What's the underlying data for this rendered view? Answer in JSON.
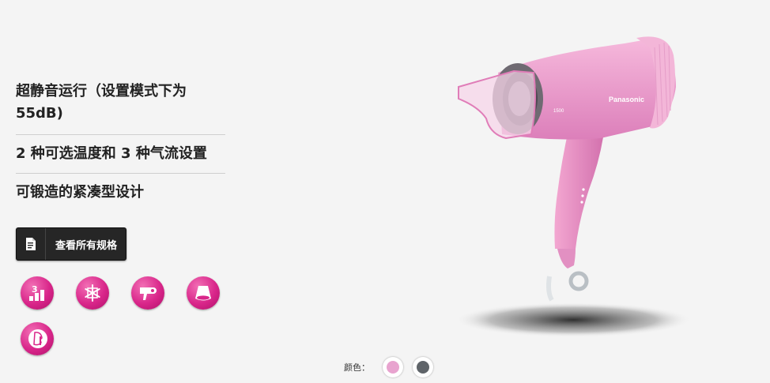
{
  "features": [
    "超静音运行（设置模式下为 55dB)",
    "2 种可选温度和 3 种气流设置",
    "可锻造的紧凑型设计"
  ],
  "spec_button": {
    "label": "查看所有规格",
    "icon": "document-icon"
  },
  "feature_icons": [
    "airflow-3-level-icon",
    "cool-snowflake-icon",
    "hair-dryer-icon",
    "concentrator-nozzle-icon",
    "quiet-shh-icon"
  ],
  "product": {
    "brand": "Panasonic",
    "wattage": "1500",
    "color": "#f09cc9"
  },
  "color_picker": {
    "label": "颜色：",
    "swatches": [
      {
        "name": "pink",
        "color": "#e8a3cf"
      },
      {
        "name": "gray",
        "color": "#5f6469"
      }
    ]
  }
}
